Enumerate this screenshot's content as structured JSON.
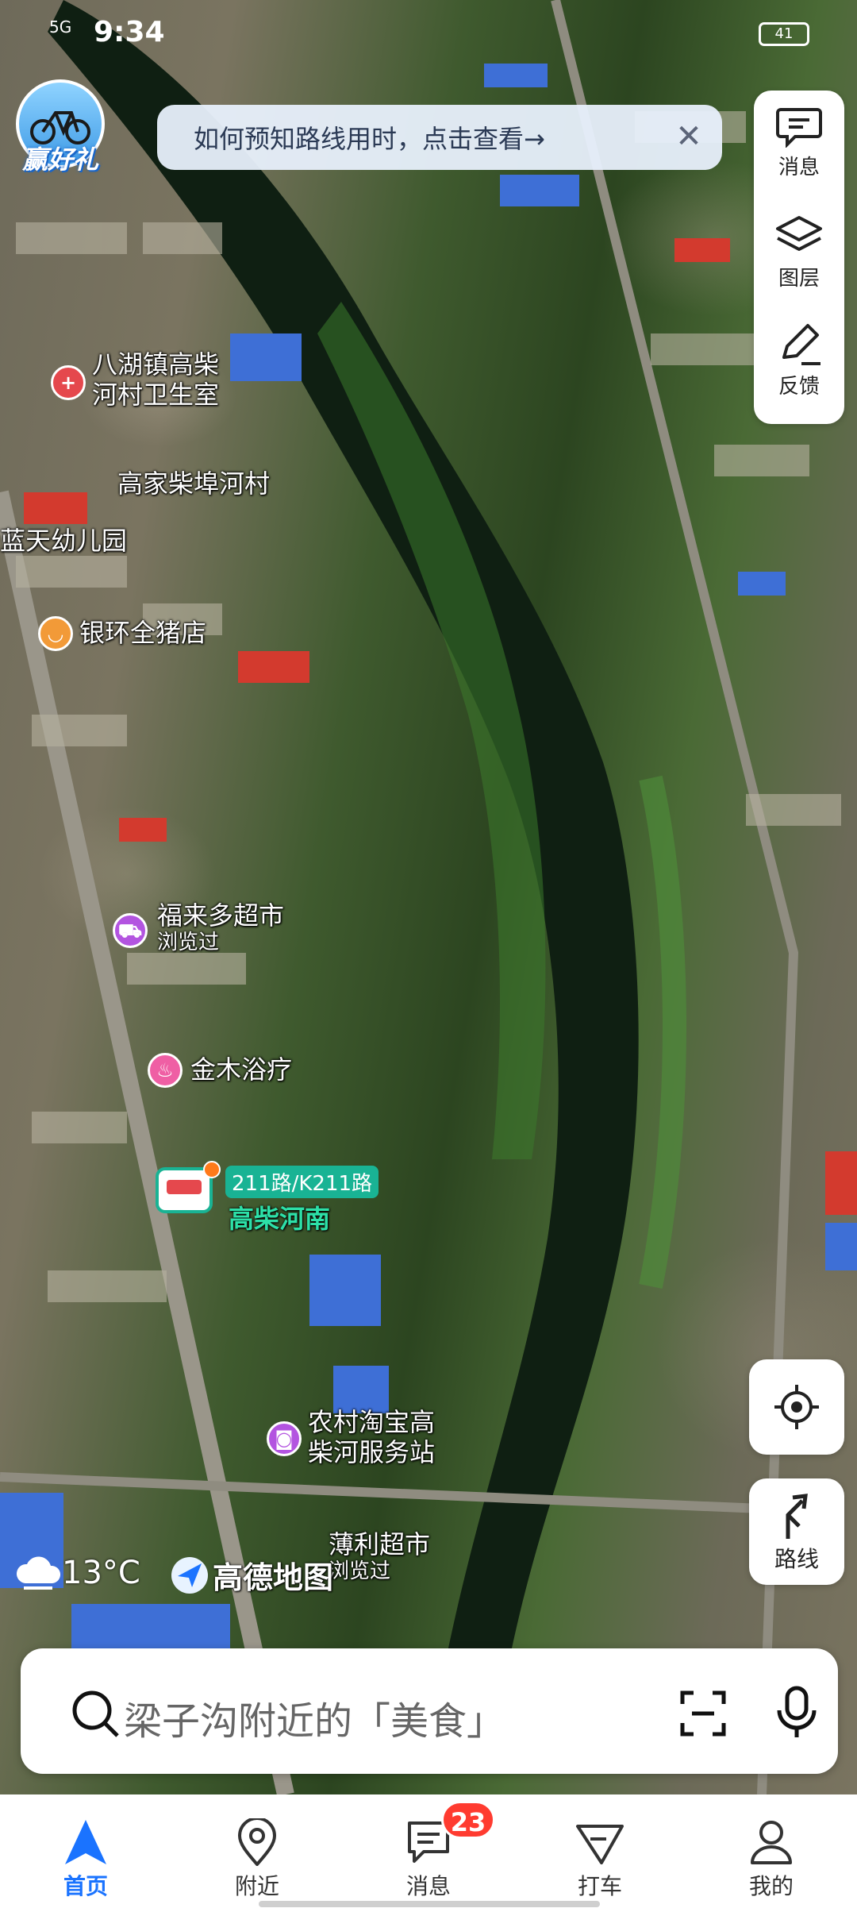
{
  "status_bar": {
    "time": "9:34",
    "network": "5G",
    "battery": "41"
  },
  "promo_badge": {
    "label": "赢好礼"
  },
  "tip_banner": {
    "text": "如何预知路线用时，点击查看→"
  },
  "map_tools": [
    {
      "label": "消息",
      "icon": "message-icon"
    },
    {
      "label": "图层",
      "icon": "layers-icon"
    },
    {
      "label": "反馈",
      "icon": "feedback-pencil-icon"
    }
  ],
  "route_button": {
    "label": "路线"
  },
  "poi": {
    "clinic": {
      "line1": "八湖镇高柴",
      "line2": "河村卫生室"
    },
    "village": "高家柴埠河村",
    "kindergarten": "蓝天幼儿园",
    "pig_shop": "银环全猪店",
    "supermarket1": {
      "name": "福来多超市",
      "note": "浏览过"
    },
    "bath": "金木浴疗",
    "taobao": {
      "line1": "农村淘宝高",
      "line2": "柴河服务站"
    },
    "supermarket2": {
      "name": "薄利超市",
      "note": "浏览过"
    }
  },
  "bus_stop": {
    "lines": "211路/K211路",
    "name": "高柴河南"
  },
  "weather": {
    "temp": "13°C",
    "icon": "cloud-icon"
  },
  "brand": {
    "name": "高德地图"
  },
  "search": {
    "placeholder": "梁子沟附近的「美食」"
  },
  "bottom_nav": [
    {
      "label": "首页",
      "icon": "home-arrow-icon",
      "active": true
    },
    {
      "label": "附近",
      "icon": "location-pin-icon"
    },
    {
      "label": "消息",
      "icon": "message-icon",
      "badge": "23"
    },
    {
      "label": "打车",
      "icon": "taxi-icon"
    },
    {
      "label": "我的",
      "icon": "profile-icon"
    }
  ],
  "colors": {
    "accent": "#1a73ff",
    "bus_green": "#19b394",
    "badge_red": "#ff3b30"
  }
}
